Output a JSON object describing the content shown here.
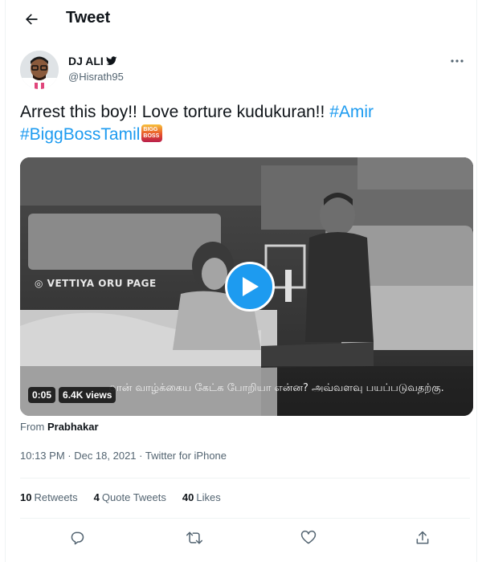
{
  "header": {
    "back_icon": "arrow-left-icon",
    "title": "Tweet"
  },
  "author": {
    "name": "DJ ALI",
    "name_suffix_icon": "bird-icon",
    "handle": "@Hisrath95"
  },
  "tweet": {
    "text_prefix": "Arrest this boy!! Love torture kudukuran!! ",
    "hashtags": [
      "#Amir",
      "#BiggBossTamil"
    ],
    "emoji_label": "BIGG BOSS"
  },
  "video": {
    "watermark": "VETTIYA ORU PAGE",
    "subtitle": "ான் வாழ்க்கைய கேட்க போறியா என்ன? அவ்வளவு பயப்படுவதற்கு.",
    "duration": "0:05",
    "views": "6.4K views"
  },
  "from": {
    "label": "From",
    "source": "Prabhakar"
  },
  "timestamp": "10:13 PM · Dec 18, 2021 · Twitter for iPhone",
  "stats": [
    {
      "count": "10",
      "label": "Retweets"
    },
    {
      "count": "4",
      "label": "Quote Tweets"
    },
    {
      "count": "40",
      "label": "Likes"
    }
  ],
  "actions": [
    "reply-icon",
    "retweet-icon",
    "like-icon",
    "share-icon"
  ],
  "colors": {
    "accent": "#1d9bf0",
    "text": "#0f1419",
    "secondary": "#536471",
    "divider": "#eff3f4"
  }
}
